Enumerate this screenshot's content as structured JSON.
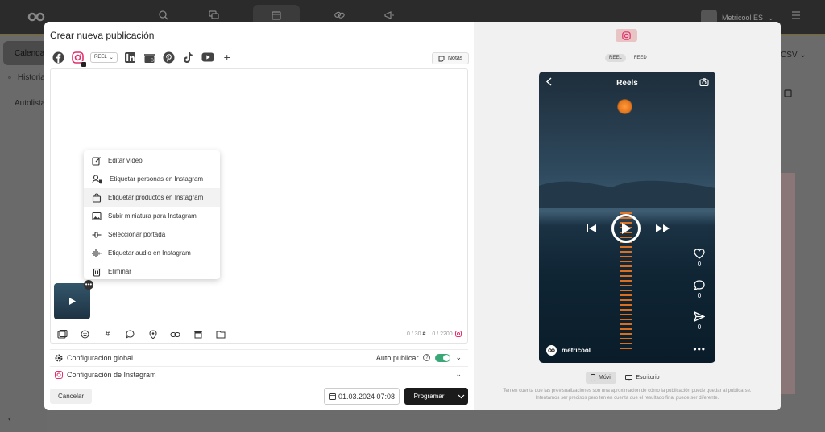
{
  "modal": {
    "title": "Crear nueva publicación",
    "reel_selector": "REEL",
    "notes_label": "Notas",
    "context_menu": [
      {
        "label": "Editar vídeo",
        "icon": "edit-icon"
      },
      {
        "label": "Etiquetar personas en Instagram",
        "icon": "tag-people-icon"
      },
      {
        "label": "Etiquetar productos en Instagram",
        "icon": "shopping-bag-icon"
      },
      {
        "label": "Subir miniatura para Instagram",
        "icon": "image-icon"
      },
      {
        "label": "Seleccionar portada",
        "icon": "cover-slider-icon"
      },
      {
        "label": "Etiquetar audio en Instagram",
        "icon": "audio-wave-icon"
      },
      {
        "label": "Eliminar",
        "icon": "trash-icon"
      }
    ],
    "counts": {
      "hashtags": "0 / 30",
      "chars": "0 / 2200"
    },
    "config_global": "Configuración global",
    "auto_publish": "Auto publicar",
    "config_instagram": "Configuración de Instagram",
    "cancel": "Cancelar",
    "date": "01.03.2024 07:08",
    "schedule": "Programar"
  },
  "preview": {
    "tabs": [
      "REEL",
      "FEED"
    ],
    "phone_title": "Reels",
    "likes": "0",
    "comments": "0",
    "shares": "0",
    "account": "metricool",
    "view_tabs": [
      "Móvil",
      "Escritorio"
    ],
    "disclaimer_1": "Ten en cuenta que las previsualizaciones son una aproximación de cómo la publicación puede quedar al publicarse.",
    "disclaimer_2": "Intentamos ser precisos pero ten en cuenta que el resultado final puede ser diferente."
  },
  "app": {
    "account_name": "Metricool ES",
    "sidebar": [
      "Calendario",
      "Historial",
      "Autolistas"
    ],
    "csv_label": "CSV"
  },
  "colors": {
    "accent": "#3aa876",
    "primary_button": "#1b1b1b",
    "instagram": "#e1306c"
  }
}
